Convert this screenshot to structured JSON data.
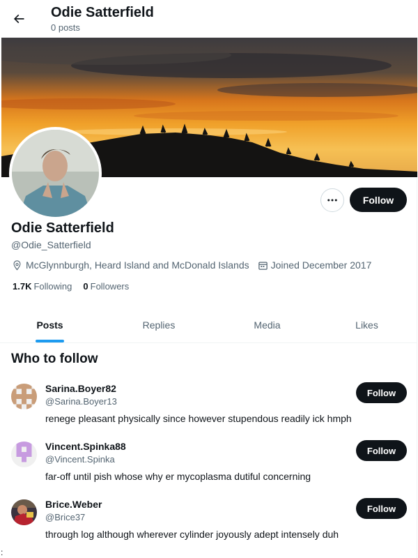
{
  "header": {
    "back_icon": "arrow-left-icon",
    "name": "Odie Satterfield",
    "posts": "0 posts"
  },
  "profile": {
    "name": "Odie Satterfield",
    "handle": "@Odie_Satterfield",
    "location": "McGlynnburgh, Heard Island and McDonald Islands",
    "joined": "Joined December 2017",
    "following_count": "1.7K",
    "following_label": "Following",
    "followers_count": "0",
    "followers_label": "Followers",
    "follow_label": "Follow",
    "more_icon": "more-dots-icon",
    "location_icon": "location-pin-icon",
    "calendar_icon": "calendar-icon"
  },
  "tabs": [
    {
      "label": "Posts",
      "active": true
    },
    {
      "label": "Replies",
      "active": false
    },
    {
      "label": "Media",
      "active": false
    },
    {
      "label": "Likes",
      "active": false
    }
  ],
  "who_to_follow": {
    "title": "Who to follow",
    "items": [
      {
        "name": "Sarina.Boyer82",
        "handle": "@Sarina.Boyer13",
        "bio": "renege pleasant physically since however stupendous readily ick hmph",
        "follow_label": "Follow"
      },
      {
        "name": "Vincent.Spinka88",
        "handle": "@Vincent.Spinka",
        "bio": "far-off until pish whose why er mycoplasma dutiful concerning",
        "follow_label": "Follow"
      },
      {
        "name": "Brice.Weber",
        "handle": "@Brice37",
        "bio": "through log although wherever cylinder joyously adept intensely duh",
        "follow_label": "Follow"
      }
    ]
  },
  "corner_mark": ":",
  "colors": {
    "accent": "#1d9bf0",
    "button_dark": "#0f1419",
    "secondary_text": "#536471"
  }
}
